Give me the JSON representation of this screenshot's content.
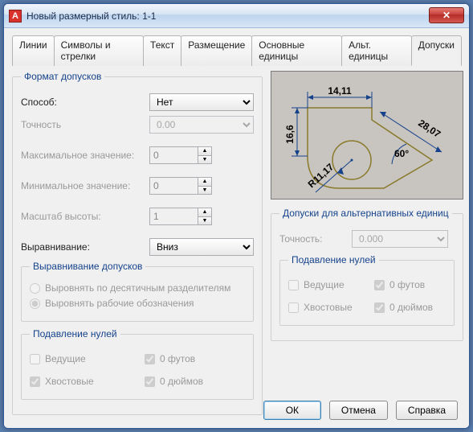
{
  "window": {
    "title": "Новый размерный стиль: 1-1"
  },
  "tabs": [
    "Линии",
    "Символы и стрелки",
    "Текст",
    "Размещение",
    "Основные единицы",
    "Альт. единицы",
    "Допуски"
  ],
  "active_tab": 6,
  "fmt": {
    "legend": "Формат допусков",
    "method_label": "Способ:",
    "method_value": "Нет",
    "precision_label": "Точность",
    "precision_value": "0.00",
    "max_label": "Максимальное значение:",
    "max_value": "0",
    "min_label": "Минимальное значение:",
    "min_value": "0",
    "scale_label": "Масштаб высоты:",
    "scale_value": "1",
    "align_label": "Выравнивание:",
    "align_value": "Вниз"
  },
  "tol_align": {
    "legend": "Выравнивание допусков",
    "opt1": "Выровнять по десятичным разделителям",
    "opt2": "Выровнять рабочие обозначения"
  },
  "zero_suppress": {
    "legend": "Подавление нулей",
    "leading": "Ведущие",
    "trailing": "Хвостовые",
    "feet": "0 футов",
    "inches": "0 дюймов"
  },
  "alt_tol": {
    "legend": "Допуски для альтернативных единиц",
    "precision_label": "Точность:",
    "precision_value": "0.000",
    "zero_legend": "Подавление нулей",
    "leading": "Ведущие",
    "trailing": "Хвостовые",
    "feet": "0 футов",
    "inches": "0 дюймов"
  },
  "preview": {
    "d_top": "14,11",
    "d_left": "16,6",
    "d_right": "28,07",
    "d_radius": "R11,17",
    "d_angle": "60°"
  },
  "buttons": {
    "ok": "ОК",
    "cancel": "Отмена",
    "help": "Справка"
  }
}
